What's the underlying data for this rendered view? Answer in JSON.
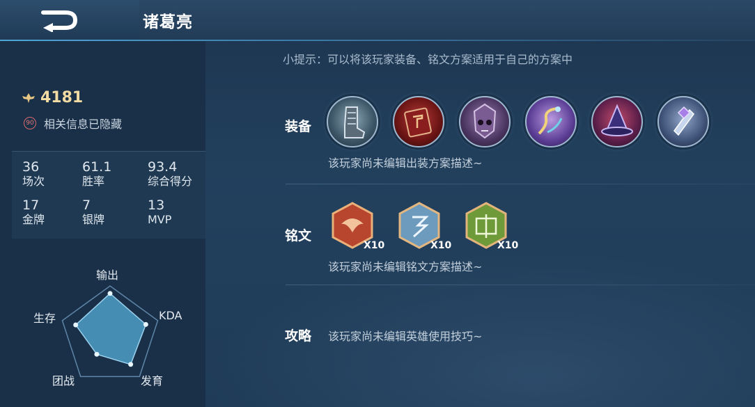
{
  "header": {
    "title": "诸葛亮"
  },
  "profile": {
    "rank_score": "4181",
    "hidden_info": "相关信息已隐藏",
    "hidden_badge": "90"
  },
  "stats": [
    {
      "value": "36",
      "label": "场次"
    },
    {
      "value": "61.1",
      "label": "胜率"
    },
    {
      "value": "93.4",
      "label": "综合得分"
    },
    {
      "value": "17",
      "label": "金牌"
    },
    {
      "value": "7",
      "label": "银牌"
    },
    {
      "value": "13",
      "label": "MVP"
    }
  ],
  "radar": {
    "labels": [
      "输出",
      "KDA",
      "发育",
      "团战",
      "生存"
    ],
    "values": [
      0.85,
      0.75,
      0.7,
      0.45,
      0.72
    ]
  },
  "tip": "小提示：可以将该玩家装备、铭文方案适用于自己的方案中",
  "equipment": {
    "label": "装备",
    "items": [
      "boots-icon",
      "tome-icon",
      "skull-mask-icon",
      "serpent-staff-icon",
      "witch-hat-icon",
      "crystal-blade-icon"
    ],
    "description": "该玩家尚未编辑出装方案描述~"
  },
  "inscription": {
    "label": "铭文",
    "runes": [
      {
        "icon": "red-rune-icon",
        "count": "X10"
      },
      {
        "icon": "blue-rune-icon",
        "count": "X10"
      },
      {
        "icon": "green-rune-icon",
        "count": "X10"
      }
    ],
    "description": "该玩家尚未编辑铭文方案描述~"
  },
  "strategy": {
    "label": "攻略",
    "description": "该玩家尚未编辑英雄使用技巧~"
  }
}
